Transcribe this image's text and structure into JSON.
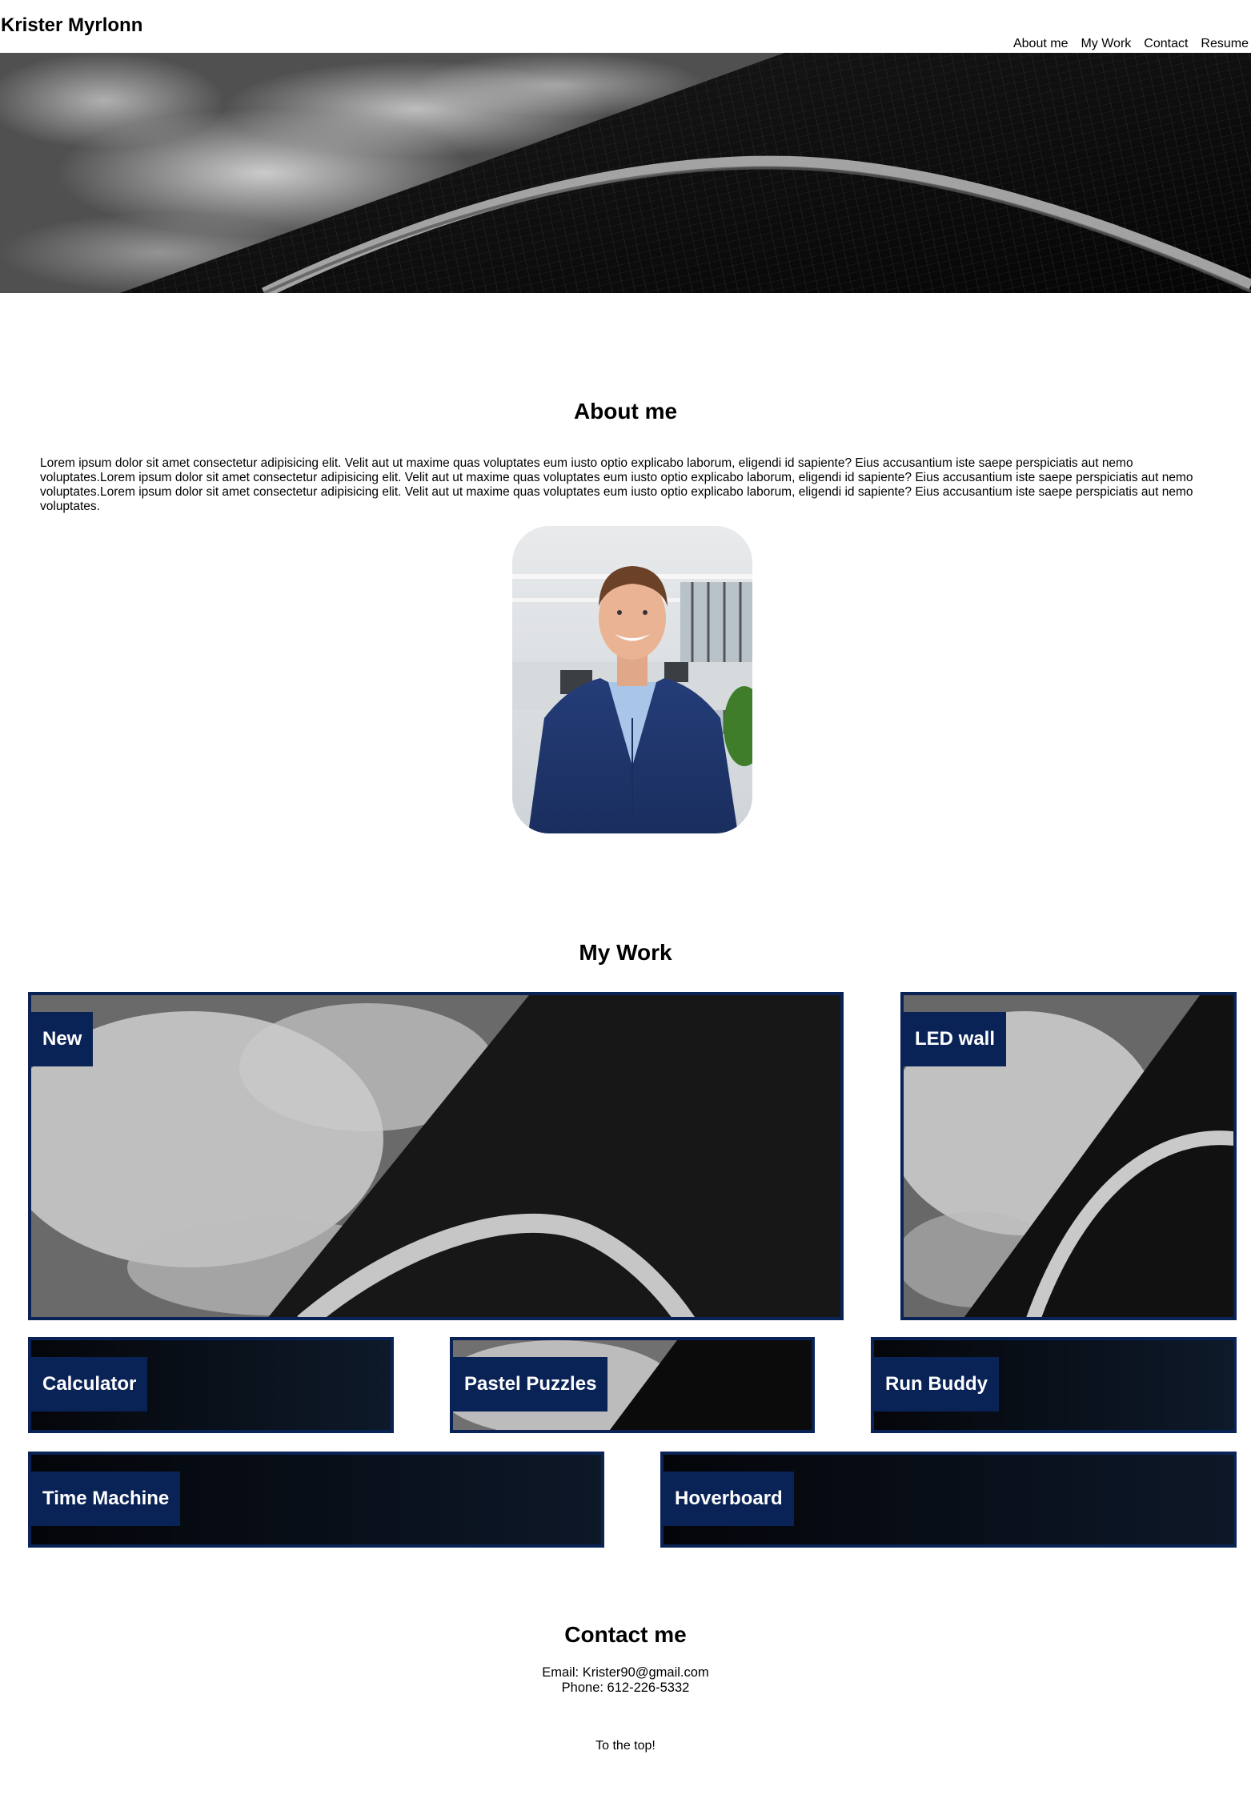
{
  "header": {
    "brand": "Krister Myrlonn",
    "nav": [
      "About me",
      "My Work",
      "Contact",
      "Resume"
    ]
  },
  "about": {
    "title": "About me",
    "text": "Lorem ipsum dolor sit amet consectetur adipisicing elit. Velit aut ut maxime quas voluptates eum iusto optio explicabo laborum, eligendi id sapiente? Eius accusantium iste saepe perspiciatis aut nemo voluptates.Lorem ipsum dolor sit amet consectetur adipisicing elit. Velit aut ut maxime quas voluptates eum iusto optio explicabo laborum, eligendi id sapiente? Eius accusantium iste saepe perspiciatis aut nemo voluptates.Lorem ipsum dolor sit amet consectetur adipisicing elit. Velit aut ut maxime quas voluptates eum iusto optio explicabo laborum, eligendi id sapiente? Eius accusantium iste saepe perspiciatis aut nemo voluptates."
  },
  "work": {
    "title": "My Work",
    "projects": [
      "New",
      "LED wall",
      "Calculator",
      "Pastel Puzzles",
      "Run Buddy",
      "Time Machine",
      "Hoverboard"
    ]
  },
  "contact": {
    "title": "Contact me",
    "email": "Email: Krister90@gmail.com",
    "phone": "Phone: 612-226-5332"
  },
  "footer": {
    "to_top": "To the top!"
  },
  "colors": {
    "accent": "#0a2356",
    "background": "#ffffff"
  }
}
